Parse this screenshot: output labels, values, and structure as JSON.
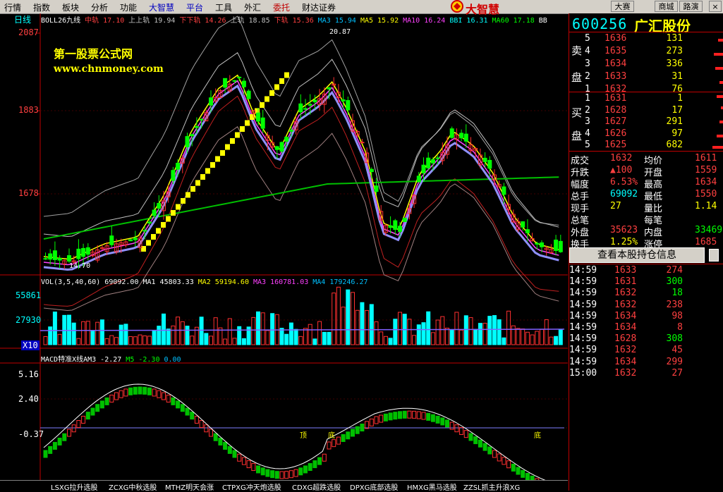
{
  "menu": [
    {
      "label": "行情",
      "color": "black"
    },
    {
      "label": "指数",
      "color": "black"
    },
    {
      "label": "板块",
      "color": "black"
    },
    {
      "label": "分析",
      "color": "black"
    },
    {
      "label": "功能",
      "color": "black"
    },
    {
      "label": "大智慧",
      "color": "blue"
    },
    {
      "label": "平台",
      "color": "blue"
    },
    {
      "label": "工具",
      "color": "black"
    },
    {
      "label": "外汇",
      "color": "black"
    },
    {
      "label": "委托",
      "color": "red"
    },
    {
      "label": "财达证券",
      "color": "black"
    }
  ],
  "logo_text": "大智慧",
  "toolbar_right": {
    "contest": "大赛",
    "mall": "商城",
    "roadshow": "路演",
    "minimize": "_",
    "restore": "□",
    "close": "×"
  },
  "chart": {
    "period_label": "日线",
    "boll_line": [
      {
        "text": "BOLL26九线",
        "color": "#ffffff"
      },
      {
        "text": "中轨 17.10",
        "color": "#ff4040"
      },
      {
        "text": "上上轨 19.94",
        "color": "#c0c0c0"
      },
      {
        "text": "下下轨 14.26",
        "color": "#ff4040"
      },
      {
        "text": "上轨 18.85",
        "color": "#c0c0c0"
      },
      {
        "text": "下轨 15.36",
        "color": "#ff4040"
      },
      {
        "text": "MA3 15.94",
        "color": "#00c0ff"
      },
      {
        "text": "MA5 15.92",
        "color": "#ffff00"
      },
      {
        "text": "MA10 16.24",
        "color": "#ff40ff"
      },
      {
        "text": "BBI 16.31",
        "color": "#00ffff"
      },
      {
        "text": "MA60 17.18",
        "color": "#00ff00"
      },
      {
        "text": "BB",
        "color": "#ffffff"
      }
    ],
    "price_labels": [
      "2087",
      "1883",
      "1678"
    ],
    "high_mark": "20.87",
    "low_mark": "14.70",
    "watermark_title": "第一股票公式网",
    "watermark_url": "www.chnmoney.com",
    "vol_line": [
      {
        "text": "VOL(3,5,40,60)",
        "color": "#ffffff"
      },
      {
        "text": "69092.00",
        "color": "#ffffff"
      },
      {
        "text": "MA1 45803.33",
        "color": "#ffffff"
      },
      {
        "text": "MA2 59194.60",
        "color": "#ffff00"
      },
      {
        "text": "MA3 160781.03",
        "color": "#ff40ff"
      },
      {
        "text": "MA4 179246.27",
        "color": "#00c0ff"
      }
    ],
    "vol_labels": [
      "55861",
      "27930",
      "X10"
    ],
    "macd_line": [
      {
        "text": "MACD特准X线AM3 -2.27",
        "color": "#ffffff"
      },
      {
        "text": "M5 -2.30",
        "color": "#00ff00"
      },
      {
        "text": "0.00",
        "color": "#00c0ff"
      }
    ],
    "macd_labels": [
      "5.16",
      "2.40",
      "-0.37"
    ],
    "macd_marks": [
      "顶",
      "底",
      "底"
    ]
  },
  "tabs": [
    "LSXG拉升选股",
    "ZCXG中秋选股",
    "MTHZ明天会涨",
    "CTPXG冲天炮选股",
    "CDXG超跌选股",
    "DPXG底部选股",
    "HMXG黑马选股",
    "ZZSL抓主升浪XG"
  ],
  "stock": {
    "code": "600256",
    "name": "广汇股份"
  },
  "order_book": {
    "sell_label": [
      "卖",
      "盘"
    ],
    "buy_label": [
      "买",
      "盘"
    ],
    "sells": [
      {
        "level": "5",
        "price": "1636",
        "vol": "131"
      },
      {
        "level": "4",
        "price": "1635",
        "vol": "273"
      },
      {
        "level": "3",
        "price": "1634",
        "vol": "336"
      },
      {
        "level": "2",
        "price": "1633",
        "vol": "31"
      },
      {
        "level": "1",
        "price": "1632",
        "vol": "76"
      }
    ],
    "buys": [
      {
        "level": "1",
        "price": "1631",
        "vol": "1"
      },
      {
        "level": "2",
        "price": "1628",
        "vol": "17"
      },
      {
        "level": "3",
        "price": "1627",
        "vol": "291"
      },
      {
        "level": "4",
        "price": "1626",
        "vol": "97"
      },
      {
        "level": "5",
        "price": "1625",
        "vol": "682"
      }
    ]
  },
  "quote": [
    {
      "l1": "成交",
      "v1": "1632",
      "c1": "#ff4040",
      "l2": "均价",
      "v2": "1611",
      "c2": "#ff4040"
    },
    {
      "l1": "升跌",
      "v1": "▲100",
      "c1": "#ff4040",
      "l2": "开盘",
      "v2": "1559",
      "c2": "#ff4040"
    },
    {
      "l1": "幅度",
      "v1": "6.53%",
      "c1": "#ff4040",
      "l2": "最高",
      "v2": "1634",
      "c2": "#ff4040"
    },
    {
      "l1": "总手",
      "v1": "69092",
      "c1": "#00ffff",
      "l2": "最低",
      "v2": "1550",
      "c2": "#ff4040"
    },
    {
      "l1": "现手",
      "v1": "27",
      "c1": "#ffff00",
      "l2": "量比",
      "v2": "1.14",
      "c2": "#ffff00"
    },
    {
      "l1": "总笔",
      "v1": "",
      "c1": "#ffff00",
      "l2": "每笔",
      "v2": "",
      "c2": "#ffffff"
    },
    {
      "l1": "外盘",
      "v1": "35623",
      "c1": "#ff4040",
      "l2": "内盘",
      "v2": "33469",
      "c2": "#00ff00"
    },
    {
      "l1": "换手",
      "v1": "1.25%",
      "c1": "#ffff00",
      "l2": "涨停",
      "v2": "1685",
      "c2": "#ff4040"
    }
  ],
  "hold_button": "查看本股持仓信息",
  "ticks": [
    {
      "time": "14:59",
      "price": "1633",
      "vol": "274",
      "vc": "#ff4040"
    },
    {
      "time": "14:59",
      "price": "1631",
      "vol": "300",
      "vc": "#00ff00"
    },
    {
      "time": "14:59",
      "price": "1632",
      "vol": "18",
      "vc": "#00ff00"
    },
    {
      "time": "14:59",
      "price": "1632",
      "vol": "238",
      "vc": "#ff4040"
    },
    {
      "time": "14:59",
      "price": "1634",
      "vol": "98",
      "vc": "#ff4040"
    },
    {
      "time": "14:59",
      "price": "1634",
      "vol": "8",
      "vc": "#ff4040"
    },
    {
      "time": "14:59",
      "price": "1628",
      "vol": "308",
      "vc": "#00ff00"
    },
    {
      "time": "14:59",
      "price": "1632",
      "vol": "45",
      "vc": "#ff4040"
    },
    {
      "time": "14:59",
      "price": "1634",
      "vol": "299",
      "vc": "#ff4040"
    },
    {
      "time": "15:00",
      "price": "1632",
      "vol": "27",
      "vc": "#ff4040"
    }
  ]
}
